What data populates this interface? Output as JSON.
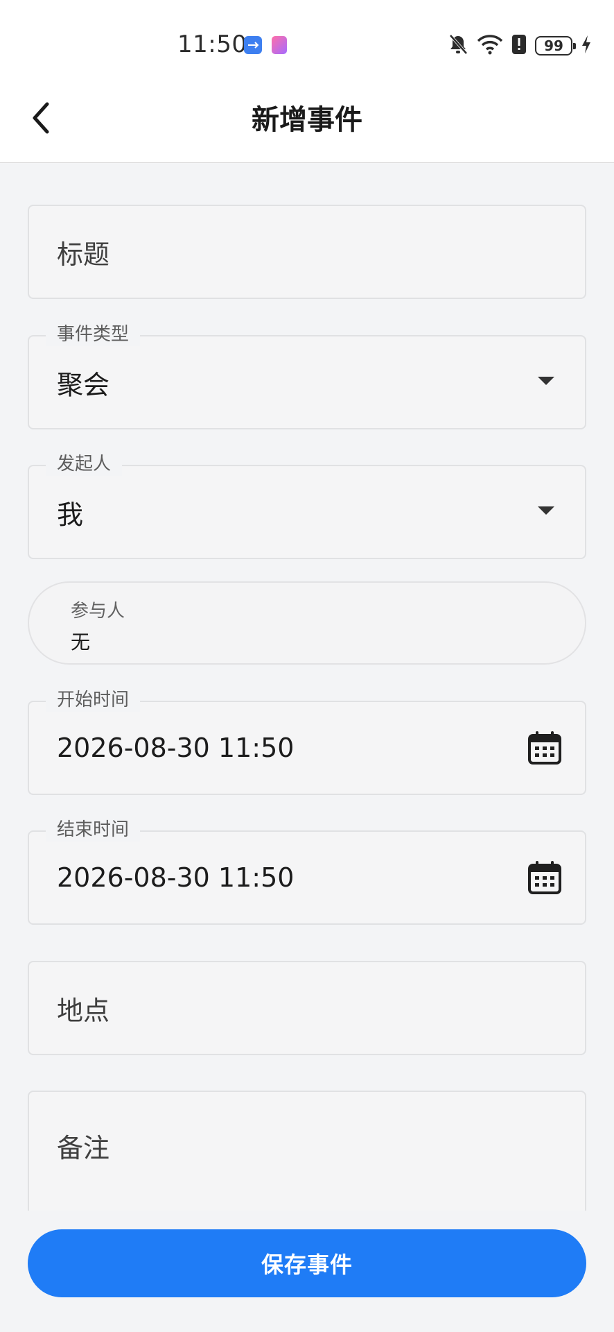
{
  "status_bar": {
    "time": "11:50",
    "battery": "99",
    "icons": [
      "usb-debug-icon",
      "app-notification-icon",
      "bell-off-icon",
      "wifi-icon",
      "alert-icon",
      "battery-icon",
      "charging-icon"
    ]
  },
  "header": {
    "title": "新增事件",
    "back_icon": "chevron-left-icon"
  },
  "form": {
    "title_field": {
      "placeholder": "标题"
    },
    "event_type": {
      "label": "事件类型",
      "value": "聚会"
    },
    "initiator": {
      "label": "发起人",
      "value": "我"
    },
    "participants": {
      "label": "参与人",
      "value": "无"
    },
    "start_time": {
      "label": "开始时间",
      "value": "2026-08-30 11:50"
    },
    "end_time": {
      "label": "结束时间",
      "value": "2026-08-30 11:50"
    },
    "location": {
      "placeholder": "地点"
    },
    "notes": {
      "placeholder": "备注"
    }
  },
  "actions": {
    "save_label": "保存事件"
  },
  "colors": {
    "primary": "#1f7cf6",
    "background": "#f3f4f6",
    "field_border": "#e0e1e3"
  }
}
